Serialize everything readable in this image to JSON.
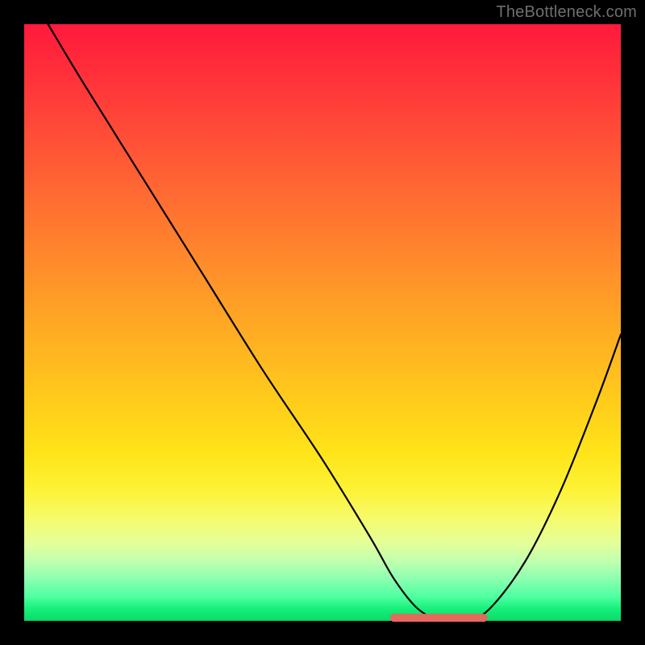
{
  "watermark": {
    "text": "TheBottleneck.com"
  },
  "chart_data": {
    "type": "line",
    "title": "",
    "xlabel": "",
    "ylabel": "",
    "xlim": [
      0,
      100
    ],
    "ylim": [
      0,
      100
    ],
    "grid": false,
    "legend": false,
    "background_gradient": {
      "direction": "vertical",
      "stops": [
        {
          "pos": 0,
          "color": "#ff1a3c"
        },
        {
          "pos": 50,
          "color": "#ffb020"
        },
        {
          "pos": 78,
          "color": "#fff040"
        },
        {
          "pos": 100,
          "color": "#0ad968"
        }
      ]
    },
    "series": [
      {
        "name": "bottleneck-curve",
        "color": "#000000",
        "x": [
          4,
          10,
          20,
          30,
          40,
          50,
          58,
          62,
          66,
          70,
          74,
          78,
          84,
          90,
          96,
          100
        ],
        "y": [
          100,
          90,
          74,
          58,
          42,
          27,
          14,
          7,
          2,
          0,
          0,
          2,
          10,
          22,
          37,
          48
        ]
      }
    ],
    "annotations": [
      {
        "name": "optimal-range-marker",
        "type": "segment",
        "color": "#e36a5c",
        "x": [
          62,
          77
        ],
        "y": [
          0.5,
          0.5
        ]
      }
    ]
  }
}
